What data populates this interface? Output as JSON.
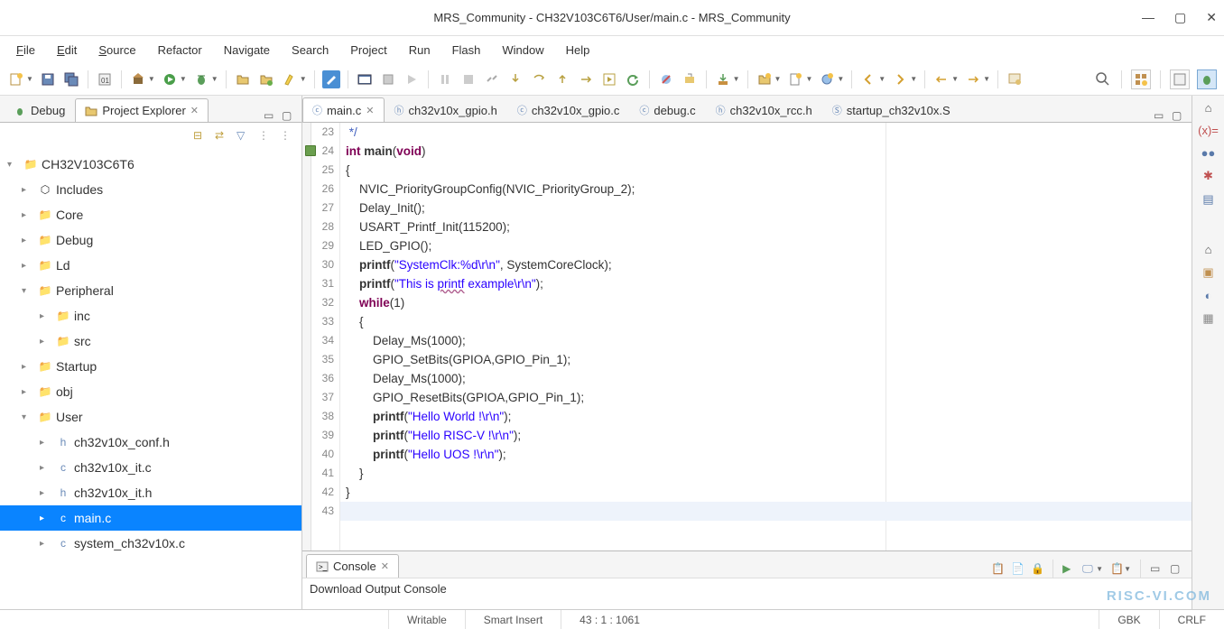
{
  "window": {
    "title": "MRS_Community - CH32V103C6T6/User/main.c - MRS_Community"
  },
  "menu": {
    "file": "File",
    "edit": "Edit",
    "source": "Source",
    "refactor": "Refactor",
    "navigate": "Navigate",
    "search": "Search",
    "project": "Project",
    "run": "Run",
    "flash": "Flash",
    "window": "Window",
    "help": "Help"
  },
  "views": {
    "debug": "Debug",
    "project_explorer": "Project Explorer"
  },
  "tree": {
    "project": "CH32V103C6T6",
    "includes": "Includes",
    "core": "Core",
    "debug": "Debug",
    "ld": "Ld",
    "peripheral": "Peripheral",
    "inc": "inc",
    "src": "src",
    "startup": "Startup",
    "obj": "obj",
    "user": "User",
    "conf_h": "ch32v10x_conf.h",
    "it_c": "ch32v10x_it.c",
    "it_h": "ch32v10x_it.h",
    "main_c": "main.c",
    "system_c": "system_ch32v10x.c"
  },
  "editor": {
    "tabs": {
      "main": "main.c",
      "gpio_h": "ch32v10x_gpio.h",
      "gpio_c": "ch32v10x_gpio.c",
      "debug_c": "debug.c",
      "rcc_h": "ch32v10x_rcc.h",
      "startup_s": "startup_ch32v10x.S"
    },
    "lines": {
      "n23": "23",
      "n24": "24",
      "n25": "25",
      "n26": "26",
      "n27": "27",
      "n28": "28",
      "n29": "29",
      "n30": "30",
      "n31": "31",
      "n32": "32",
      "n33": "33",
      "n34": "34",
      "n35": "35",
      "n36": "36",
      "n37": "37",
      "n38": "38",
      "n39": "39",
      "n40": "40",
      "n41": "41",
      "n42": "42",
      "n43": "43"
    },
    "code": {
      "l23": " */",
      "l24_int": "int",
      "l24_main": " main",
      "l24_void": "void",
      "l24_end": ")",
      "l25": "{",
      "l26": "    NVIC_PriorityGroupConfig(NVIC_PriorityGroup_2);",
      "l27": "    Delay_Init();",
      "l28": "    USART_Printf_Init(115200);",
      "l29": "    LED_GPIO();",
      "l30_pf": "    printf",
      "l30_str": "\"SystemClk:%d\\r\\n\"",
      "l30_end": ", SystemCoreClock);",
      "l31_pf": "    printf",
      "l31_a": "\"This is ",
      "l31_b": "printf",
      "l31_c": " example\\r\\n\"",
      "l31_end": ");",
      "l32_while": "    while",
      "l32_end": "(1)",
      "l33": "    {",
      "l34": "        Delay_Ms(1000);",
      "l35": "        GPIO_SetBits(GPIOA,GPIO_Pin_1);",
      "l36": "        Delay_Ms(1000);",
      "l37": "        GPIO_ResetBits(GPIOA,GPIO_Pin_1);",
      "l38_pf": "        printf",
      "l38_str": "\"Hello World !\\r\\n\"",
      "l38_end": ");",
      "l39_pf": "        printf",
      "l39_str": "\"Hello RISC-V !\\r\\n\"",
      "l39_end": ");",
      "l40_pf": "        printf",
      "l40_str": "\"Hello UOS !\\r\\n\"",
      "l40_end": ");",
      "l41": "    }",
      "l42": "}",
      "l43": ""
    }
  },
  "console": {
    "title": "Console",
    "content": "Download Output Console"
  },
  "status": {
    "writable": "Writable",
    "smart_insert": "Smart Insert",
    "cursor": "43 : 1 : 1061",
    "encoding": "GBK",
    "eol": "CRLF"
  },
  "watermark": "RISC-VI.COM"
}
